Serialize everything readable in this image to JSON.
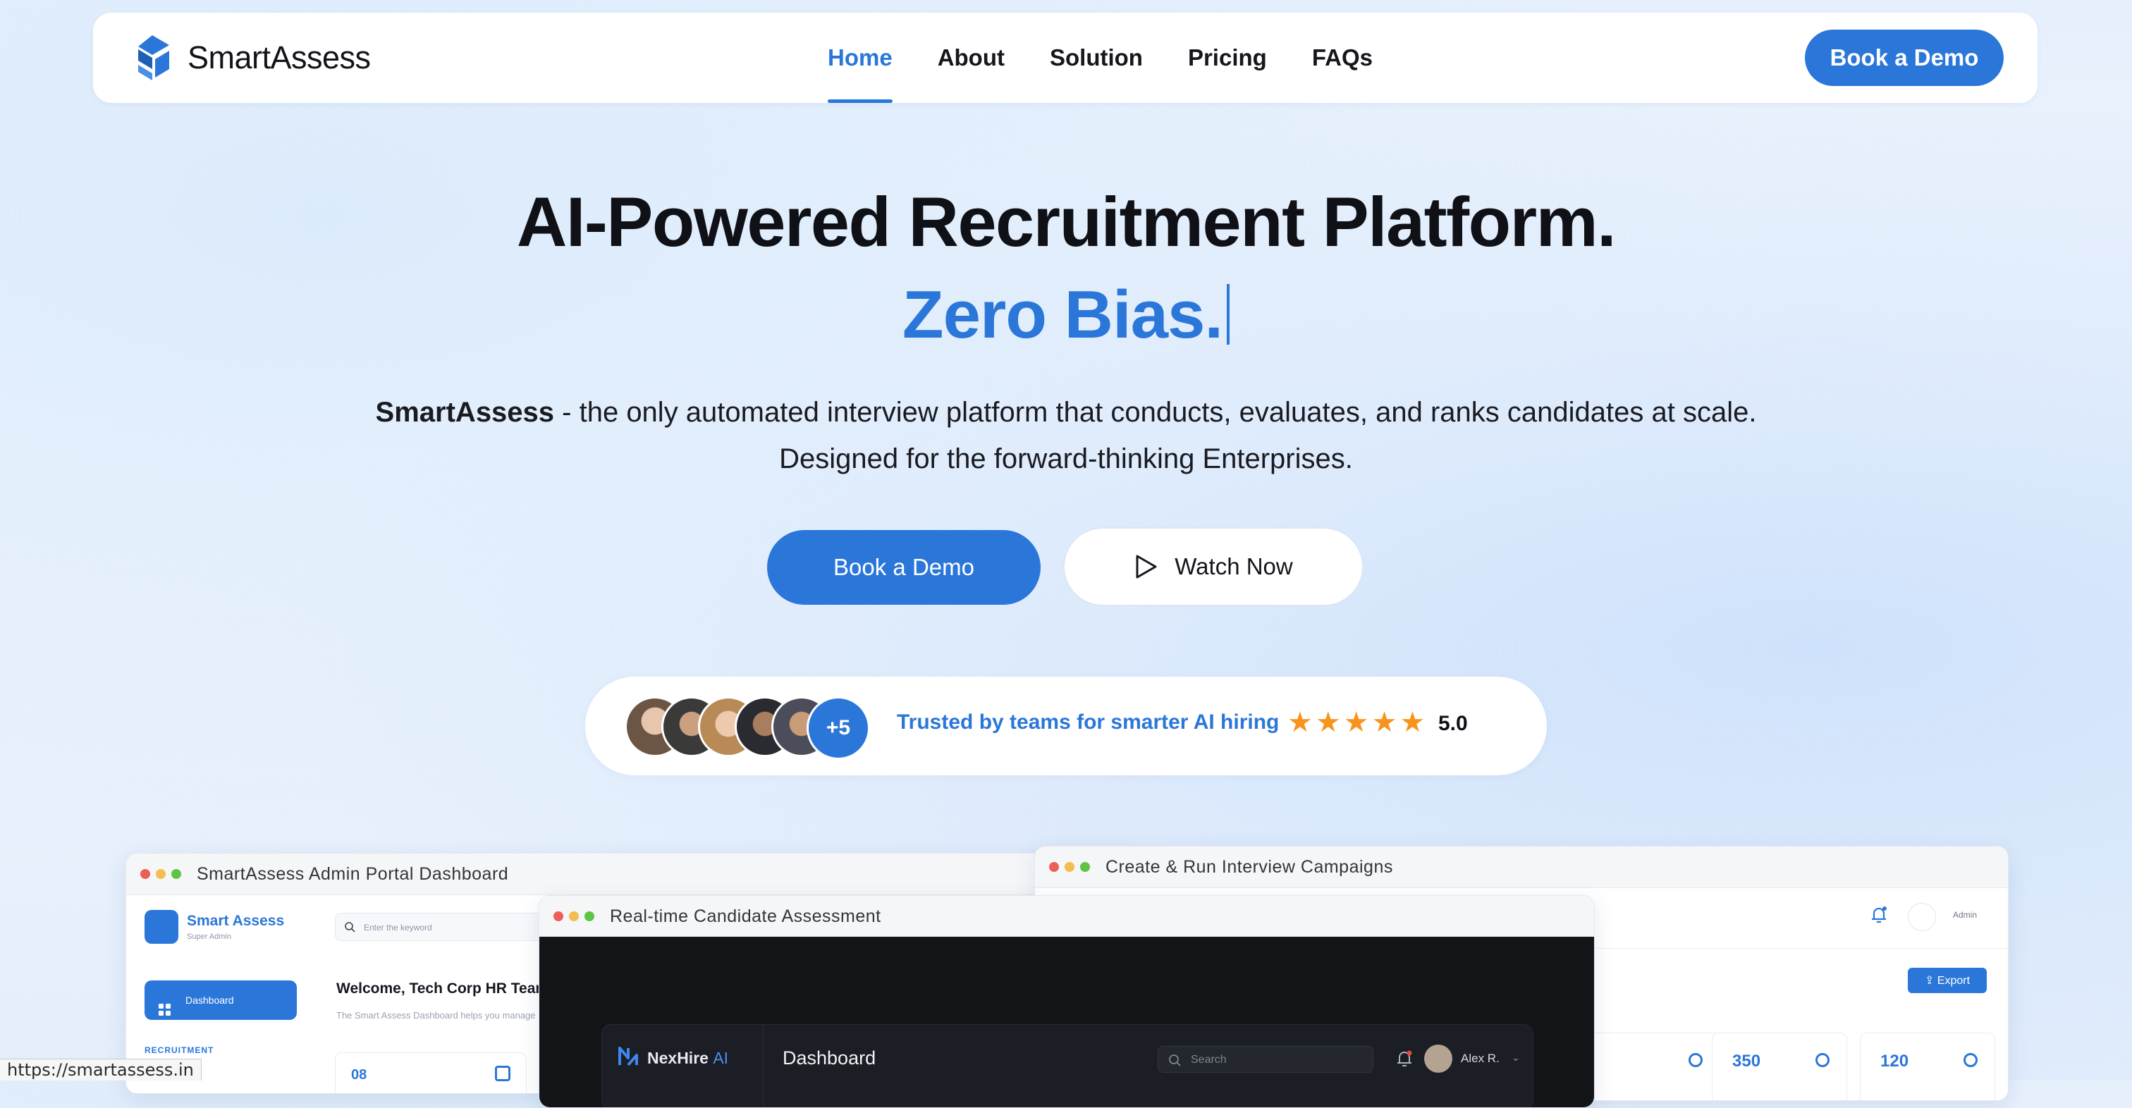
{
  "nav": {
    "brand": "SmartAssess",
    "items": [
      {
        "label": "Home",
        "active": true
      },
      {
        "label": "About"
      },
      {
        "label": "Solution"
      },
      {
        "label": "Pricing"
      },
      {
        "label": "FAQs"
      }
    ],
    "cta": "Book a Demo"
  },
  "hero": {
    "title": "AI-Powered Recruitment Platform.",
    "tagline": "Zero Bias.",
    "brand_bold": "SmartAssess",
    "description": " - the only automated interview platform that conducts, evaluates, and ranks candidates at scale. Designed for the forward-thinking Enterprises.",
    "primary_cta": "Book a Demo",
    "secondary_cta": "Watch Now"
  },
  "trust": {
    "more_count": "+5",
    "text": "Trusted by teams for smarter AI hiring",
    "stars": "★★★★★",
    "rating": "5.0"
  },
  "admin_window": {
    "title": "SmartAssess Admin Portal Dashboard",
    "brand": "Smart Assess",
    "role": "Super Admin",
    "search_placeholder": "Enter the keyword",
    "nav_active": "Dashboard",
    "section_label": "RECRUITMENT",
    "welcome": "Welcome, Tech Corp HR Team",
    "description": "The Smart Assess Dashboard helps you manage",
    "stat": "08"
  },
  "campaign_window": {
    "title": "Create & Run Interview Campaigns",
    "user": "Admin",
    "export": "Export",
    "stats": [
      "350",
      "120"
    ]
  },
  "assessment_window": {
    "title": "Real-time Candidate Assessment",
    "brand": "NexHire",
    "brand_suffix": "AI",
    "page": "Dashboard",
    "search_placeholder": "Search",
    "user": "Alex R."
  },
  "status_url": "https://smartassess.in",
  "colors": {
    "accent": "#2b77d9",
    "stars": "#f7941d",
    "dark": "#121418"
  }
}
